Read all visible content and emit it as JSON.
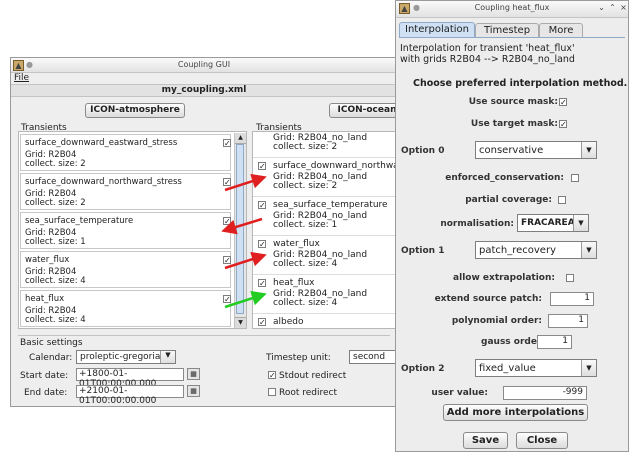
{
  "main": {
    "title": "Coupling GUI",
    "menu_file": "File",
    "xml_name": "my_coupling.xml",
    "left_comp": "ICON-atmosphere",
    "right_comp": "ICON-ocean",
    "transients_label": "Transients",
    "left_items": [
      {
        "name": "surface_downward_eastward_stress",
        "grid": "Grid: R2B04",
        "size": "collect. size: 2"
      },
      {
        "name": "surface_downward_northward_stress",
        "grid": "Grid: R2B04",
        "size": "collect. size: 2"
      },
      {
        "name": "sea_surface_temperature",
        "grid": "Grid: R2B04",
        "size": "collect. size: 1"
      },
      {
        "name": "water_flux",
        "grid": "Grid: R2B04",
        "size": "collect. size: 4"
      },
      {
        "name": "heat_flux",
        "grid": "Grid: R2B04",
        "size": "collect. size: 4"
      }
    ],
    "right_partial": {
      "grid": "Grid: R2B04_no_land",
      "size": "collect. size: 2"
    },
    "right_items": [
      {
        "name": "surface_downward_northwar",
        "grid": "Grid: R2B04_no_land",
        "size": "collect. size: 2"
      },
      {
        "name": "sea_surface_temperature",
        "grid": "Grid: R2B04_no_land",
        "size": "collect. size: 1"
      },
      {
        "name": "water_flux",
        "grid": "Grid: R2B04_no_land",
        "size": "collect. size: 4"
      },
      {
        "name": "heat_flux",
        "grid": "Grid: R2B04_no_land",
        "size": "collect. size: 4"
      },
      {
        "name": "albedo"
      }
    ],
    "arrow_colors": [
      "#e02020",
      "#e02020",
      "#e02020",
      "#22cc22"
    ],
    "basic_settings": "Basic settings",
    "calendar_label": "Calendar:",
    "calendar_value": "proleptic-gregorian",
    "start_label": "Start date:",
    "start_value": "+1800-01-01T00:00:00.000",
    "end_label": "End date:",
    "end_value": "+2100-01-01T00:00:00.000",
    "timestep_unit_label": "Timestep unit:",
    "timestep_unit_value": "second",
    "stdout_label": "Stdout redirect",
    "root_label": "Root redirect"
  },
  "dialog": {
    "title": "Coupling heat_flux",
    "tabs": [
      "Interpolation",
      "Timestep",
      "More"
    ],
    "desc_line1": "Interpolation for transient 'heat_flux'",
    "desc_line2": "with grids R2B04 --> R2B04_no_land",
    "choose": "Choose preferred interpolation method.",
    "use_source_mask": "Use source mask:",
    "use_target_mask": "Use target mask:",
    "option0_label": "Option 0",
    "option0_value": "conservative",
    "enforced": "enforced_conservation:",
    "partial": "partial coverage:",
    "normalisation": "normalisation:",
    "normalisation_value": "FRACAREA",
    "option1_label": "Option 1",
    "option1_value": "patch_recovery",
    "allow_extrap": "allow extrapolation:",
    "extend_label": "extend source patch:",
    "extend_value": "1",
    "poly_label": "polynomial order:",
    "poly_value": "1",
    "gauss_label": "gauss order:",
    "gauss_value": "1",
    "option2_label": "Option 2",
    "option2_value": "fixed_value",
    "user_value_label": "user value:",
    "user_value": "-999",
    "add_more": "Add more interpolations",
    "save": "Save",
    "close": "Close"
  }
}
